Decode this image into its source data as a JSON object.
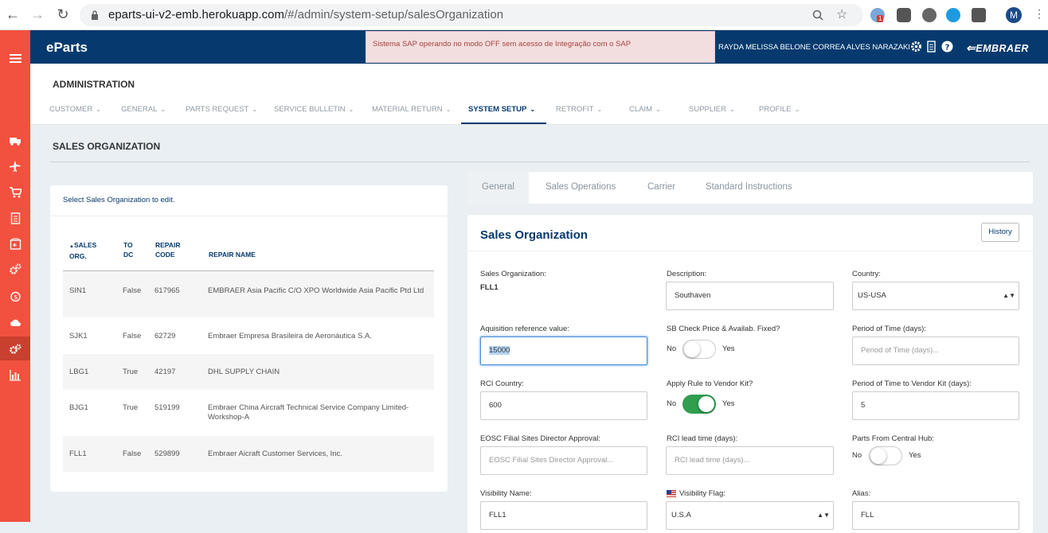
{
  "browser": {
    "url_host": "eparts-ui-v2-emb.herokuapp.com",
    "url_path": "/#/admin/system-setup/salesOrganization",
    "profile_initial": "M",
    "ext_badge": "1"
  },
  "header": {
    "brand": "eParts",
    "alert": "Sistema SAP operando no modo OFF sem acesso de Integração com o SAP",
    "user": "RAYDA MELISSA BELONE CORREA ALVES NARAZAKI",
    "logo": "EMBRAER"
  },
  "admin": {
    "title": "ADMINISTRATION",
    "menu": [
      "CUSTOMER",
      "GENERAL",
      "PARTS REQUEST",
      "SERVICE BULLETIN",
      "MATERIAL RETURN",
      "SYSTEM SETUP",
      "RETROFIT",
      "CLAIM",
      "SUPPLIER",
      "PROFILE"
    ],
    "active_menu": "SYSTEM SETUP"
  },
  "page": {
    "title": "SALES ORGANIZATION"
  },
  "list": {
    "hint": "Select Sales Organization to edit.",
    "headers": {
      "sales_org": "SALES\nORG.",
      "sort_indicator": "▲",
      "to_dc": "TO\nDC",
      "repair_code": "REPAIR\nCODE",
      "repair_name": "REPAIR NAME"
    },
    "rows": [
      {
        "org": "SIN1",
        "dc": "False",
        "code": "617965",
        "name": "EMBRAER Asia Pacific C/O XPO Worldwide Asia Pacific Ptd Ltd"
      },
      {
        "org": "SJK1",
        "dc": "False",
        "code": "62729",
        "name": "Embraer Empresa Brasileira de Aeronáutica S.A."
      },
      {
        "org": "LBG1",
        "dc": "True",
        "code": "42197",
        "name": "DHL SUPPLY CHAIN"
      },
      {
        "org": "BJG1",
        "dc": "True",
        "code": "519199",
        "name": "Embraer China Aircraft Technical Service Company Limited-Workshop-A"
      },
      {
        "org": "FLL1",
        "dc": "False",
        "code": "529899",
        "name": "Embraer Aicraft Customer Services, Inc."
      }
    ]
  },
  "tabs": [
    "General",
    "Sales Operations",
    "Carrier",
    "Standard Instructions"
  ],
  "form": {
    "title": "Sales Organization",
    "history": "History",
    "sales_org_label": "Sales Organization:",
    "sales_org_value": "FLL1",
    "description_label": "Description:",
    "description_value": "Southaven",
    "country_label": "Country:",
    "country_value": "US-USA",
    "aquisition_label": "Aquisition reference value:",
    "aquisition_value": "15000",
    "sb_check_label": "SB Check Price & Availab. Fixed?",
    "period_label": "Period of Time (days):",
    "period_placeholder": "Period of Time (days)...",
    "rci_country_label": "RCI Country:",
    "rci_country_value": "600",
    "apply_rule_label": "Apply Rule to Vendor Kit?",
    "period_vendor_label": "Period of Time to Vendor Kit (days):",
    "period_vendor_value": "5",
    "eosc_label": "EOSC Filial Sites Director Approval:",
    "eosc_placeholder": "EOSC Filial Sites Director Approval...",
    "rci_lead_label": "RCI lead time (days):",
    "rci_lead_placeholder": "RCI lead time (days)...",
    "central_hub_label": "Parts From Central Hub:",
    "visibility_name_label": "Visibility Name:",
    "visibility_name_value": "FLL1",
    "visibility_flag_label": "Visibility Flag:",
    "visibility_flag_value": "U.S.A",
    "alias_label": "Alias:",
    "alias_value": "FLL",
    "no": "No",
    "yes": "Yes",
    "toggles": {
      "sb_check": false,
      "apply_rule": true,
      "central_hub": false
    }
  },
  "colors": {
    "sidebar": "#f2513f",
    "topbar": "#063a6e",
    "accent": "#063a6e",
    "toggle_on": "#2e9e4f"
  }
}
